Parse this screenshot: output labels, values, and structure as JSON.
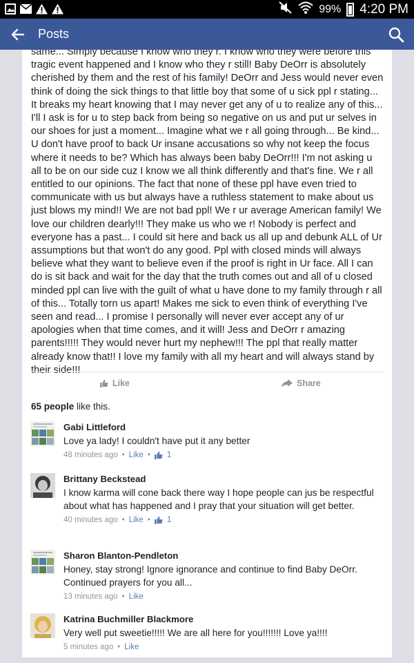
{
  "statusbar": {
    "battery": "99%",
    "time": "4:20 PM"
  },
  "appbar": {
    "title": "Posts"
  },
  "post": {
    "text": "same... Simply because I know who they r. I know who they were before this tragic event happened and I know who they r still! Baby DeOrr is absolutely cherished by them and the rest of his family! DeOrr and Jess would never even think of doing the sick things to that little boy that some of u sick ppl r stating... It breaks my heart knowing that I may never get any of u to realize any of this... I'll I ask is for u to step back from being so negative on us and put ur selves in our shoes for just a moment... Imagine what we r all going through... Be kind... U don't have proof to back Ur insane accusations so why not keep the focus where it needs to be? Which has always been baby DeOrr!!! I'm not asking u all to be on our side cuz I know we all think differently and that's fine. We r all entitled to our opinions. The fact that none of these ppl have even tried to communicate with us but always have a ruthless statement to make about us just blows my mind!! We are not bad ppl! We r ur average American family! We love our children dearly!!! They make us who we r! Nobody is perfect and everyone has a past... I could sit here and back us all up and debunk ALL of Ur assumptions but that won't do any good. Ppl with closed minds will always believe what they want to believe even if the proof is right in Ur face. All I can do is sit back and wait for the day that the truth comes out and all of u closed minded ppl can live with the guilt of what u have done to my family through r all of this... Totally torn us apart! Makes me sick to even think of everything I've seen and read... I promise I personally will never ever accept any of ur apologies when that time comes, and it will! Jess and DeOrr r amazing parents!!!!! They would never hurt my nephew!!! The ppl that really matter already know that!! I love my family with all my heart and will always stand by their side!!!",
    "like_label": "Like",
    "share_label": "Share"
  },
  "likes": {
    "count": "65 people",
    "suffix": " like this."
  },
  "comments": [
    {
      "name": "Gabi Littleford",
      "text": "Love ya lady! I couldn't have put it any better",
      "time": "48 minutes ago",
      "like_label": "Like",
      "likes": "1"
    },
    {
      "name": "Brittany Beckstead",
      "text": "I know karma will cone back there way I hope people can jus be respectful about what has happened and I pray that your situation will get better.",
      "time": "40 minutes ago",
      "like_label": "Like",
      "likes": "1"
    },
    {
      "name": "Sharon Blanton-Pendleton",
      "text": "Honey, stay strong! Ignore ignorance and continue to find Baby DeOrr. Continued prayers for you all...",
      "time": "13 minutes ago",
      "like_label": "Like"
    },
    {
      "name": "Katrina Buchmiller Blackmore",
      "text": "Very well put sweetie!!!!! We are all here for you!!!!!!!  Love ya!!!!",
      "time": "5 minutes ago",
      "like_label": "Like"
    }
  ],
  "colors": {
    "brand": "#3b5998",
    "background": "#dddfe4",
    "link": "#5b7bb4"
  }
}
